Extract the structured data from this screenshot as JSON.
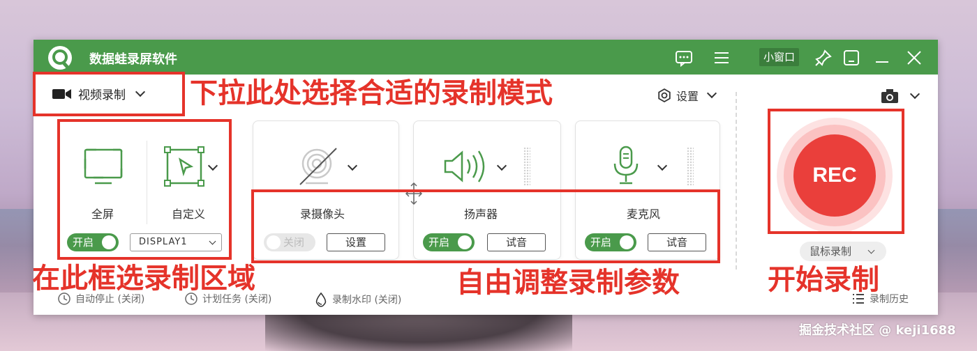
{
  "app": {
    "title": "数据蛙录屏软件",
    "small_window_label": "小窗口"
  },
  "mode": {
    "label": "视频录制"
  },
  "settings": {
    "label": "设置"
  },
  "region": {
    "fullscreen_label": "全屏",
    "custom_label": "自定义",
    "toggle_label": "开启",
    "display_value": "DISPLAY1"
  },
  "camera": {
    "label": "录摄像头",
    "toggle_label": "关闭",
    "button_label": "设置"
  },
  "speaker": {
    "label": "扬声器",
    "toggle_label": "开启",
    "button_label": "试音"
  },
  "microphone": {
    "label": "麦克风",
    "toggle_label": "开启",
    "button_label": "试音"
  },
  "rec": {
    "label": "REC",
    "mouse_record_label": "鼠标录制"
  },
  "footer": {
    "auto_stop": "自动停止 (关闭)",
    "schedule": "计划任务 (关闭)",
    "watermark": "录制水印 (关闭)",
    "history": "录制历史"
  },
  "annotations": {
    "mode_hint": "下拉此处选择合适的录制模式",
    "region_hint": "在此框选录制区域",
    "params_hint": "自由调整录制参数",
    "start_hint": "开始录制"
  },
  "watermark_text": "掘金技术社区 @ keji1688",
  "colors": {
    "brand_green": "#4a9a4b",
    "rec_red": "#ea3f3b",
    "annotation_red": "#e5332a"
  }
}
